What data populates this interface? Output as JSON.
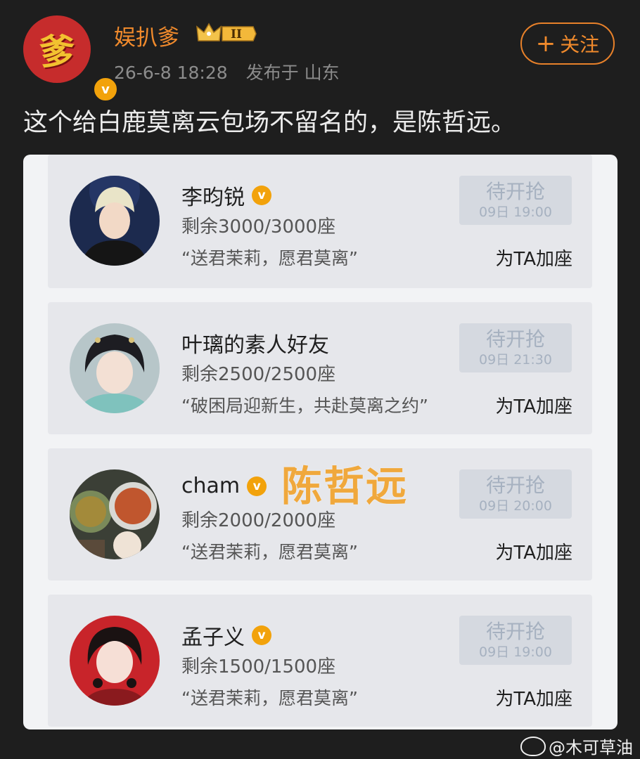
{
  "post": {
    "author": "娱扒爹",
    "avatar_char": "爹",
    "level_badge": "II",
    "date": "26-6-8 18:28",
    "location": "发布于 山东",
    "follow_label": "关注",
    "text": "这个给白鹿莫离云包场不留名的，是陈哲远。"
  },
  "cards": [
    {
      "name": "李昀锐",
      "verified": true,
      "seats": "剩余3000/3000座",
      "quote": "“送君茉莉，愿君莫离”",
      "status": "待开抢",
      "time": "09日 19:00",
      "action": "为TA加座"
    },
    {
      "name": "叶璃的素人好友",
      "verified": false,
      "seats": "剩余2500/2500座",
      "quote": "“破困局迎新生，共赴莫离之约”",
      "status": "待开抢",
      "time": "09日 21:30",
      "action": "为TA加座"
    },
    {
      "name": "cham",
      "verified": true,
      "seats": "剩余2000/2000座",
      "quote": "“送君茉莉，愿君莫离”",
      "status": "待开抢",
      "time": "09日 20:00",
      "action": "为TA加座"
    },
    {
      "name": "孟子义",
      "verified": true,
      "seats": "剩余1500/1500座",
      "quote": "“送君茉莉，愿君莫离”",
      "status": "待开抢",
      "time": "09日 19:00",
      "action": "为TA加座"
    }
  ],
  "overlay_text": "陈哲远",
  "watermark": "@木可草油",
  "colors": {
    "accent": "#f08a2c",
    "verified": "#f2a20b",
    "background": "#1e1e1e"
  }
}
